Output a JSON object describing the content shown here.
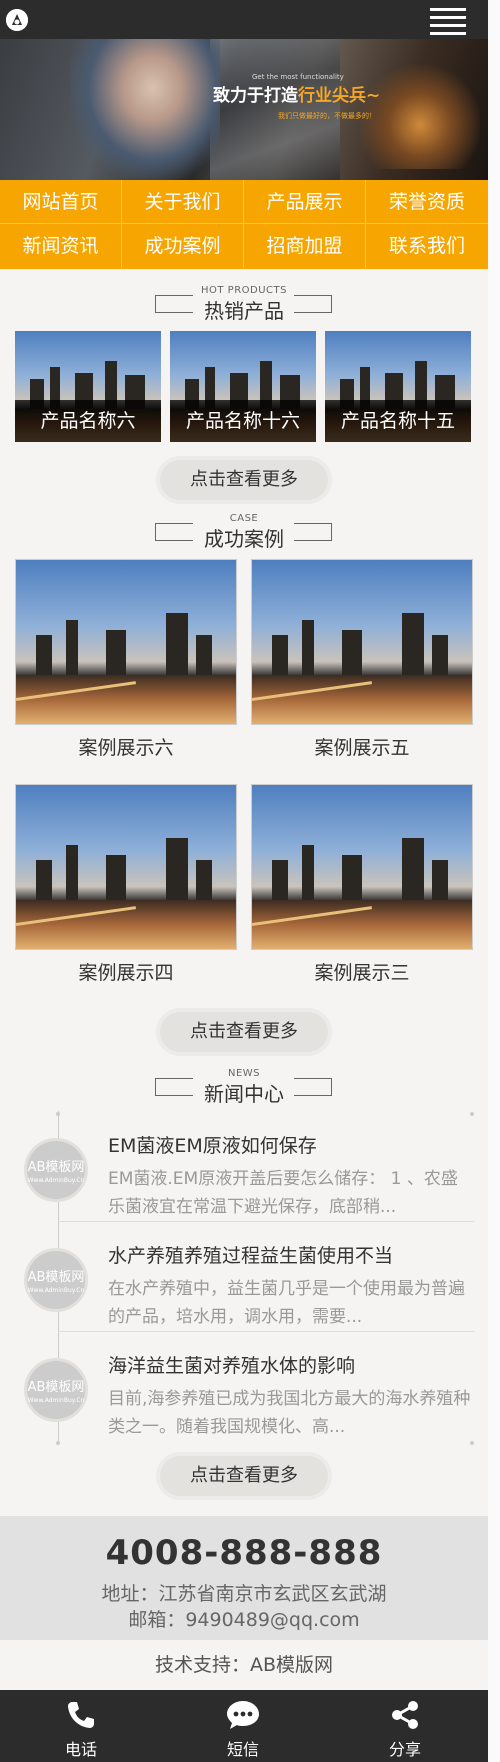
{
  "banner": {
    "eyebrow": "Get the most functionality",
    "slogan_main": "致力于打造",
    "slogan_highlight": "行业尖兵~",
    "sub": "我们只做最好的，不做最多的！"
  },
  "nav": {
    "items": [
      "网站首页",
      "关于我们",
      "产品展示",
      "荣誉资质",
      "新闻资讯",
      "成功案例",
      "招商加盟",
      "联系我们"
    ]
  },
  "hot_products": {
    "en": "HOT PRODUCTS",
    "cn": "热销产品",
    "items": [
      "产品名称六",
      "产品名称十六",
      "产品名称十五"
    ],
    "more": "点击查看更多"
  },
  "cases": {
    "en": "CASE",
    "cn": "成功案例",
    "items": [
      "案例展示六",
      "案例展示五",
      "案例展示四",
      "案例展示三"
    ],
    "more": "点击查看更多"
  },
  "news": {
    "en": "NEWS",
    "cn": "新闻中心",
    "avatar_text": "AB模板网",
    "avatar_sub": "Www.AdminBuy.Cn",
    "items": [
      {
        "title": "EM菌液EM原液如何保存",
        "desc": "EM菌液.EM原液开盖后要怎么储存： 1 、农盛乐菌液宜在常温下避光保存，底部稍..."
      },
      {
        "title": "水产养殖养殖过程益生菌使用不当",
        "desc": "在水产养殖中，益生菌几乎是一个使用最为普遍的产品，培水用，调水用，需要..."
      },
      {
        "title": "海洋益生菌对养殖水体的影响",
        "desc": "目前,海参养殖已成为我国北方最大的海水养殖种类之一。随着我国规模化、高..."
      }
    ],
    "more": "点击查看更多"
  },
  "footer": {
    "tel": "4008-888-888",
    "address": "地址：江苏省南京市玄武区玄武湖",
    "email": "邮箱：9490489@qq.com",
    "support": "技术支持：AB模版网"
  },
  "bottom_bar": {
    "phone": "电话",
    "sms": "短信",
    "share": "分享"
  }
}
